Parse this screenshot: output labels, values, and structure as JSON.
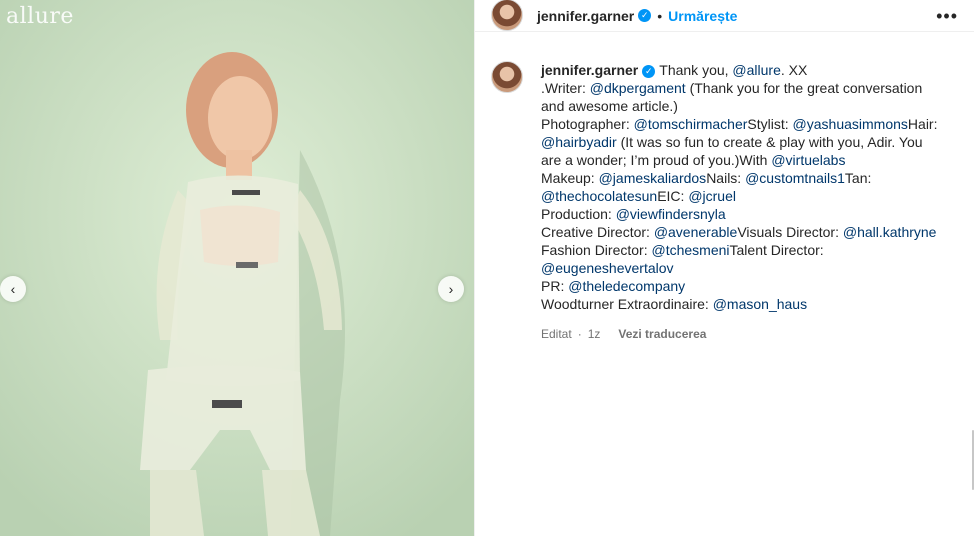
{
  "media": {
    "brand": "allure",
    "prev_icon": "‹",
    "next_icon": "›"
  },
  "header": {
    "username": "jennifer.garner",
    "verified_icon": "✓",
    "dot": "•",
    "follow_label": "Urmărește",
    "more_icon": "•••"
  },
  "caption": {
    "username": "jennifer.garner",
    "lines": [
      [
        {
          "t": "Thank you, "
        },
        {
          "m": "@allure"
        },
        {
          "t": ". XX"
        }
      ],
      [
        {
          "t": ".Writer: "
        },
        {
          "m": "@dkpergament"
        },
        {
          "t": " (Thank you for the great conversation"
        }
      ],
      [
        {
          "t": "and awesome article.)"
        }
      ],
      [
        {
          "t": "Photographer: "
        },
        {
          "m": "@tomschirmacher"
        },
        {
          "t": "Stylist: "
        },
        {
          "m": "@yashuasimmons"
        },
        {
          "t": "Hair:"
        }
      ],
      [
        {
          "m": "@hairbyadir"
        },
        {
          "t": " (It was so fun to create & play with you, Adir. You"
        }
      ],
      [
        {
          "t": "are a wonder; I’m proud of you.)With "
        },
        {
          "m": "@virtuelabs"
        }
      ],
      [
        {
          "t": "Makeup: "
        },
        {
          "m": "@jameskaliardos"
        },
        {
          "t": "Nails: "
        },
        {
          "m": "@customtnails1"
        },
        {
          "t": "Tan:"
        }
      ],
      [
        {
          "m": "@thechocolatesun"
        },
        {
          "t": "EIC: "
        },
        {
          "m": "@jcruel"
        }
      ],
      [
        {
          "t": "Production: "
        },
        {
          "m": "@viewfindersnyla"
        }
      ],
      [
        {
          "t": "Creative Director: "
        },
        {
          "m": "@avenerable"
        },
        {
          "t": "Visuals Director: "
        },
        {
          "m": "@hall.kathryne"
        }
      ],
      [
        {
          "t": "Fashion Director: "
        },
        {
          "m": "@tchesmeni"
        },
        {
          "t": "Talent Director:"
        }
      ],
      [
        {
          "m": "@eugeneshevertalov"
        }
      ],
      [
        {
          "t": "PR: "
        },
        {
          "m": "@theledecompany"
        }
      ],
      [
        {
          "t": "Woodturner Extraordinaire: "
        },
        {
          "m": "@mason_haus"
        }
      ]
    ],
    "edited": "Editat",
    "sep": "·",
    "age": "1z",
    "translate": "Vezi traducerea"
  },
  "colors": {
    "accent": "#0095f6",
    "mention": "#00376b",
    "muted": "#737373"
  }
}
